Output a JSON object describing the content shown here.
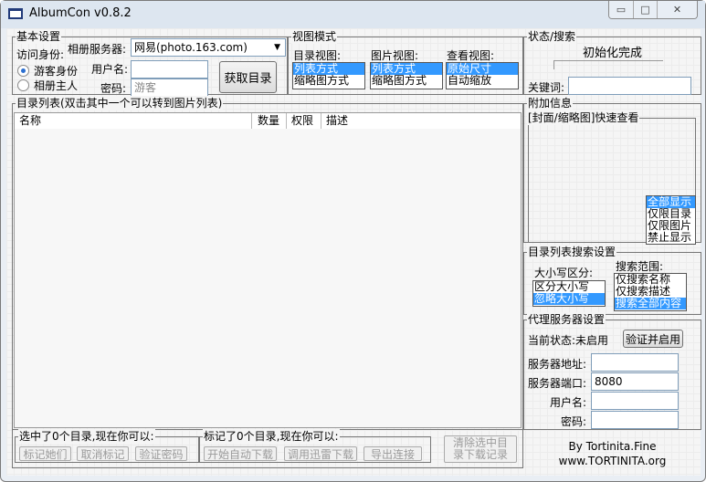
{
  "window": {
    "title": "AlbumCon v0.8.2",
    "minimize": "▭",
    "maximize": "□",
    "close": "✕"
  },
  "basic": {
    "legend": "基本设置",
    "identity_label": "访问身份:",
    "server_label": "相册服务器:",
    "server_value": "网易(photo.163.com)",
    "guest": "游客身份",
    "owner": "相册主人",
    "username_label": "用户名:",
    "username_value": "",
    "password_label": "密码:",
    "password_placeholder": "游客",
    "fetch_button": "获取目录",
    "selected_identity": "guest"
  },
  "view": {
    "legend": "视图模式",
    "dir_label": "目录视图:",
    "dir_options": [
      "列表方式",
      "缩略图方式"
    ],
    "dir_selected": 0,
    "pic_label": "图片视图:",
    "pic_options": [
      "列表方式",
      "缩略图方式"
    ],
    "pic_selected": 0,
    "look_label": "查看视图:",
    "look_options": [
      "原始尺寸",
      "自动缩放"
    ],
    "look_selected": 0
  },
  "status": {
    "legend": "状态/搜索",
    "message": "初始化完成",
    "keyword_label": "关键词:",
    "keyword_value": ""
  },
  "dirlist": {
    "legend": "目录列表(双击其中一个可以转到图片列表)",
    "columns": [
      "名称",
      "数量",
      "权限",
      "描述"
    ],
    "rows": []
  },
  "extra": {
    "legend": "附加信息",
    "preview_legend": "[封面/缩略图]快速查看",
    "display_options": [
      "全部显示",
      "仅限目录",
      "仅限图片",
      "禁止显示"
    ],
    "display_selected": 0
  },
  "search": {
    "legend": "目录列表搜索设置",
    "case_label": "大小写区分:",
    "case_options": [
      "区分大小写",
      "忽略大小写"
    ],
    "case_selected": 1,
    "range_label": "搜索范围:",
    "range_options": [
      "仅搜索名称",
      "仅搜索描述",
      "搜索全部内容"
    ],
    "range_selected": 2
  },
  "proxy": {
    "legend": "代理服务器设置",
    "state_label": "当前状态:未启用",
    "verify_button": "验证并启用",
    "address_label": "服务器地址:",
    "address_value": "",
    "port_label": "服务器端口:",
    "port_value": "8080",
    "user_label": "用户名:",
    "user_value": "",
    "pass_label": "密码:",
    "pass_value": ""
  },
  "bottom": {
    "selected_legend": "选中了0个目录,现在你可以:",
    "mark_them": "标记她们",
    "unmark": "取消标记",
    "verify_pwd": "验证密码",
    "marked_legend": "标记了0个目录,现在你可以:",
    "auto_download": "开始自动下载",
    "thunder_download": "调用迅雷下载",
    "export_links": "导出连接",
    "clear_records": "清除选中目录下载记录"
  },
  "credits": {
    "line1": "By Tortinita.Fine",
    "line2": "www.TORTINITA.org"
  }
}
